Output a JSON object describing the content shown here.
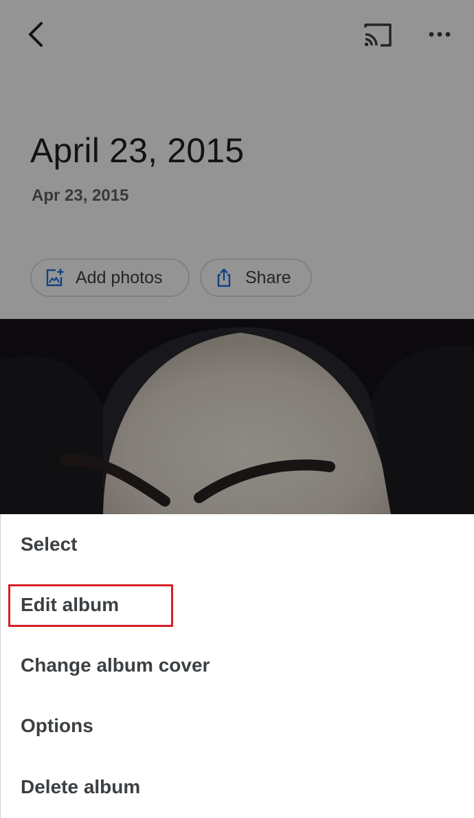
{
  "header": {
    "back_icon": "chevron-left-icon",
    "cast_icon": "cast-icon",
    "more_icon": "more-horizontal-icon"
  },
  "album": {
    "title": "April 23, 2015",
    "date": "Apr 23, 2015"
  },
  "actions": {
    "add_photos": {
      "label": "Add photos",
      "icon": "add-photo-icon"
    },
    "share": {
      "label": "Share",
      "icon": "share-icon"
    }
  },
  "colors": {
    "accent": "#1a73e8",
    "highlight_border": "#d61f26",
    "text_primary": "#202124",
    "text_secondary": "#5f6368"
  },
  "menu": {
    "items": [
      {
        "label": "Select"
      },
      {
        "label": "Edit album",
        "highlighted": true
      },
      {
        "label": "Change album cover"
      },
      {
        "label": "Options"
      },
      {
        "label": "Delete album"
      }
    ]
  }
}
